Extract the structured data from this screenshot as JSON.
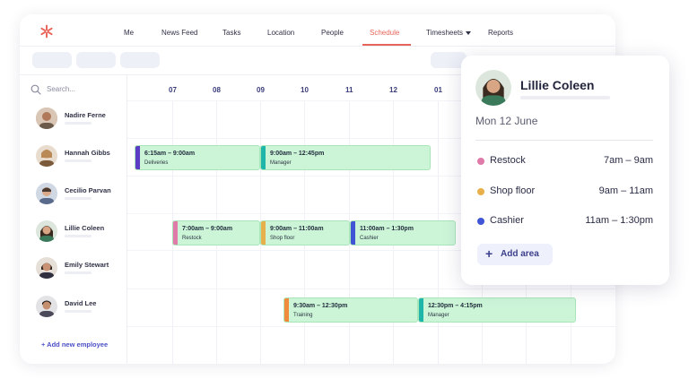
{
  "nav": {
    "items": [
      {
        "label": "Me"
      },
      {
        "label": "News Feed"
      },
      {
        "label": "Tasks"
      },
      {
        "label": "Location"
      },
      {
        "label": "People"
      },
      {
        "label": "Schedule"
      },
      {
        "label": "Timesheets"
      },
      {
        "label": "Reports"
      }
    ],
    "active": "Schedule"
  },
  "search": {
    "placeholder": "Search..."
  },
  "hours": [
    "07",
    "08",
    "09",
    "10",
    "11",
    "12",
    "01"
  ],
  "employees": [
    {
      "name": "Nadire Ferne"
    },
    {
      "name": "Hannah Gibbs"
    },
    {
      "name": "Cecilio Parvan"
    },
    {
      "name": "Lillie Coleen"
    },
    {
      "name": "Emily Stewart"
    },
    {
      "name": "David Lee"
    }
  ],
  "add_employee_label": "+ Add new employee",
  "shifts": {
    "hannah_1": {
      "time": "6:15am – 9:00am",
      "area": "Deliveries",
      "color": "#5b3cc4"
    },
    "hannah_2": {
      "time": "9:00am – 12:45pm",
      "area": "Manager",
      "color": "#1fb5a8"
    },
    "lillie_1": {
      "time": "7:00am – 9:00am",
      "area": "Restock",
      "color": "#e07aa8"
    },
    "lillie_2": {
      "time": "9:00am – 11:00am",
      "area": "Shop floor",
      "color": "#e8b04a"
    },
    "lillie_3": {
      "time": "11:00am – 1:30pm",
      "area": "Cashier",
      "color": "#3f55d6"
    },
    "david_1": {
      "time": "9:30am – 12:30pm",
      "area": "Training",
      "color": "#f08a3c"
    },
    "david_2": {
      "time": "12:30pm – 4:15pm",
      "area": "Manager",
      "color": "#1fb5a8"
    }
  },
  "card": {
    "name": "Lillie Coleen",
    "date": "Mon 12 June",
    "areas": [
      {
        "name": "Restock",
        "time": "7am – 9am",
        "color": "#e07aa8"
      },
      {
        "name": "Shop floor",
        "time": "9am – 11am",
        "color": "#e8b04a"
      },
      {
        "name": "Cashier",
        "time": "11am – 1:30pm",
        "color": "#3f55d6"
      }
    ],
    "add_area_label": "Add area"
  },
  "colors": {
    "accent": "#e8645a",
    "brand": "#4b4fc5",
    "shift_fill": "#ccf5d8"
  }
}
